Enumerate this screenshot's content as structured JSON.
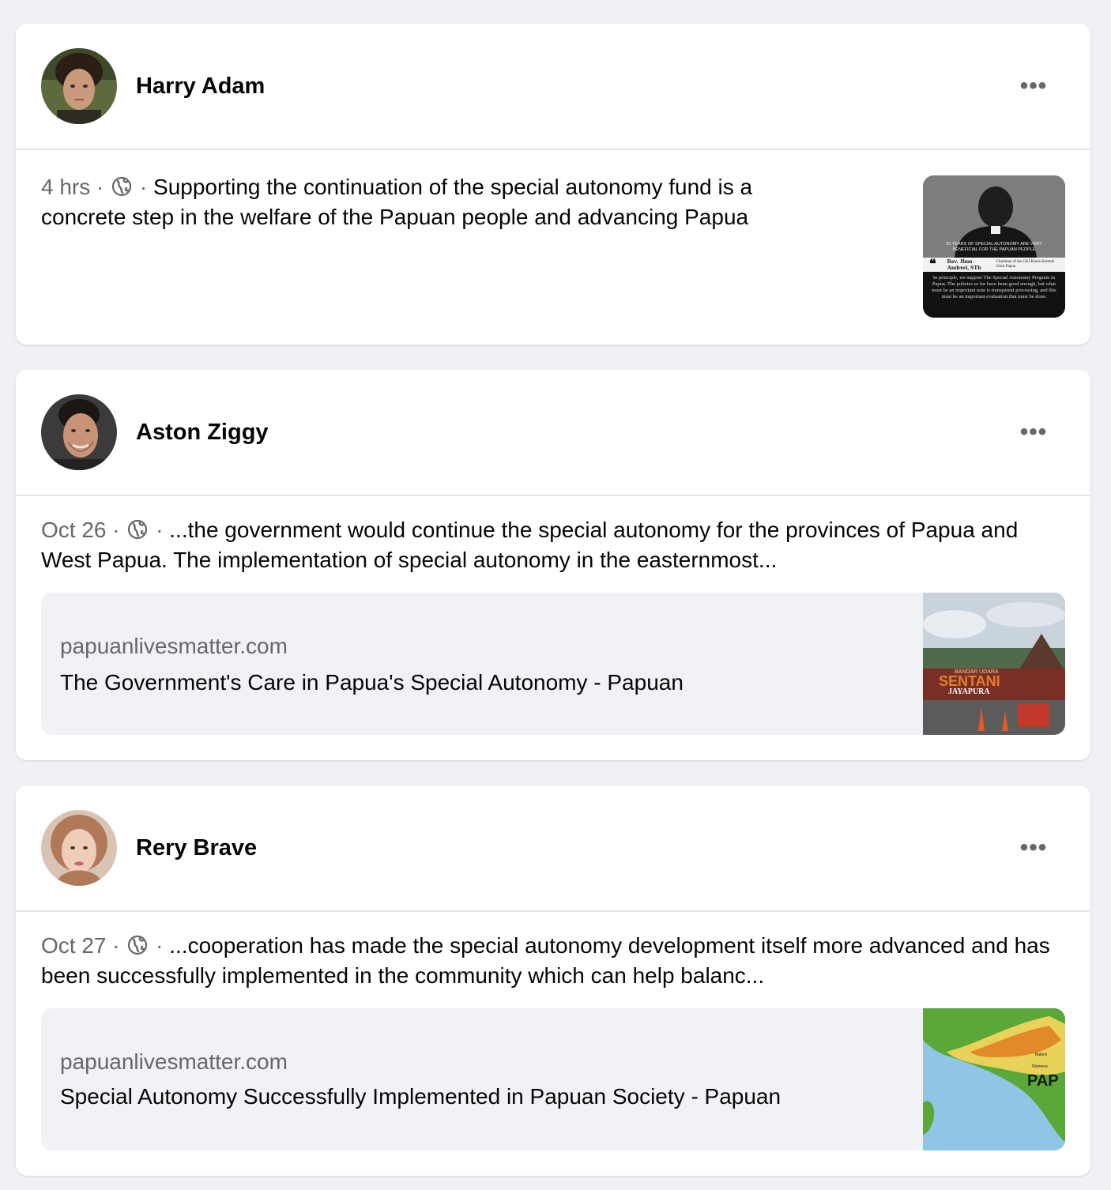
{
  "posts": [
    {
      "author": "Harry Adam",
      "time": "4 hrs",
      "separator": "·",
      "text": "Supporting the continuation of the special autonomy fund is a concrete step in the welfare of the Papuan people and advancing Papua",
      "thumbnail": {
        "heading": "20 YEARS OF SPECIAL AUTONOMY ARE VERY BENEFICIAL FOR THE PAPUAN PEOPLE",
        "name": "Rev. Jhon Andreri, STh",
        "role": "Chairman of the GKI Klasis Kemtuk Gresi Papua",
        "quote": "In principle, we support The Special Autonomy Program in Papua. The policies so far have been good enough, but what must be an important note is transparent processing, and this must be an important evaluation that must be done."
      }
    },
    {
      "author": "Aston Ziggy",
      "time": "Oct 26",
      "separator": "·",
      "text": "...the government would continue the special autonomy for the provinces of Papua and West Papua. The implementation of special autonomy in the easternmost...",
      "link": {
        "domain": "papuanlivesmatter.com",
        "title": "The Government's Care in Papua's Special Autonomy - Papuan",
        "image_text": {
          "small": "BANDAR UDARA",
          "big": "SENTANI",
          "city": "JAYAPURA"
        }
      }
    },
    {
      "author": "Rery Brave",
      "time": "Oct 27",
      "separator": "·",
      "text": "...cooperation has made the special autonomy development itself more advanced and has been successfully implemented in the community which can help balanc...",
      "link": {
        "domain": "papuanlivesmatter.com",
        "title": "Special Autonomy Successfully Implemented in Papuan Society - Papuan",
        "image_text": {
          "label": "PAP",
          "place1": "Baliem",
          "place2": "Wamena"
        }
      }
    }
  ],
  "icons": {
    "audience": "globe-icon",
    "options": "more-horizontal-icon"
  },
  "colors": {
    "background": "#eff1f4",
    "card": "#ffffff",
    "meta_text": "#65676b",
    "link_preview_bg": "#f0f2f5"
  }
}
